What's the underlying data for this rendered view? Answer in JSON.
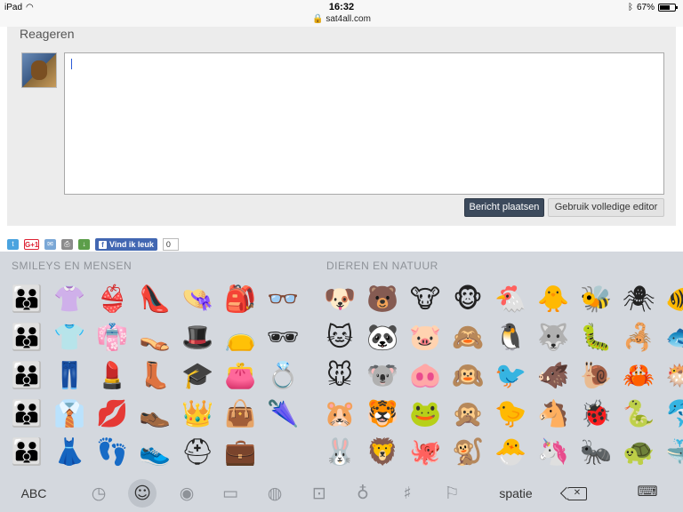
{
  "status_bar": {
    "device": "iPad",
    "time": "16:32",
    "url": "sat4all.com",
    "battery": "67%"
  },
  "reply": {
    "title": "Reageren",
    "post_button": "Bericht plaatsen",
    "full_editor_button": "Gebruik volledige editor"
  },
  "share": {
    "googleplus": "G+1",
    "fb_like": "Vind ik leuk",
    "fb_count": "0"
  },
  "keyboard": {
    "category_smileys": "SMILEYS EN MENSEN",
    "category_animals": "DIEREN EN NATUUR",
    "abc_key": "ABC",
    "space_key": "spatie",
    "smileys": [
      "👪",
      "👪",
      "👪",
      "👪",
      "👪",
      "👚",
      "👕",
      "👖",
      "👔",
      "👗",
      "👙",
      "👘",
      "💄",
      "💋",
      "👣",
      "👠",
      "👡",
      "👢",
      "👞",
      "👟",
      "👒",
      "🎩",
      "🎓",
      "👑",
      "⛑",
      "🎒",
      "👝",
      "👛",
      "👜",
      "💼",
      "👓",
      "🕶",
      "💍",
      "🌂",
      ""
    ],
    "animals": [
      "🐶",
      "🐱",
      "🐭",
      "🐹",
      "🐰",
      "🐻",
      "🐼",
      "🐨",
      "🐯",
      "🦁",
      "🐮",
      "🐷",
      "🐽",
      "🐸",
      "🐙",
      "🐵",
      "🙈",
      "🙉",
      "🙊",
      "🐒",
      "🐔",
      "🐧",
      "🐦",
      "🐤",
      "🐣",
      "🐥",
      "🐺",
      "🐗",
      "🐴",
      "🦄",
      "🐝",
      "🐛",
      "🐌",
      "🐞",
      "🐜",
      "🕷",
      "🦂",
      "🦀",
      "🐍",
      "🐢",
      "🐠",
      "🐟",
      "🐡",
      "🐬",
      "🐳"
    ]
  }
}
